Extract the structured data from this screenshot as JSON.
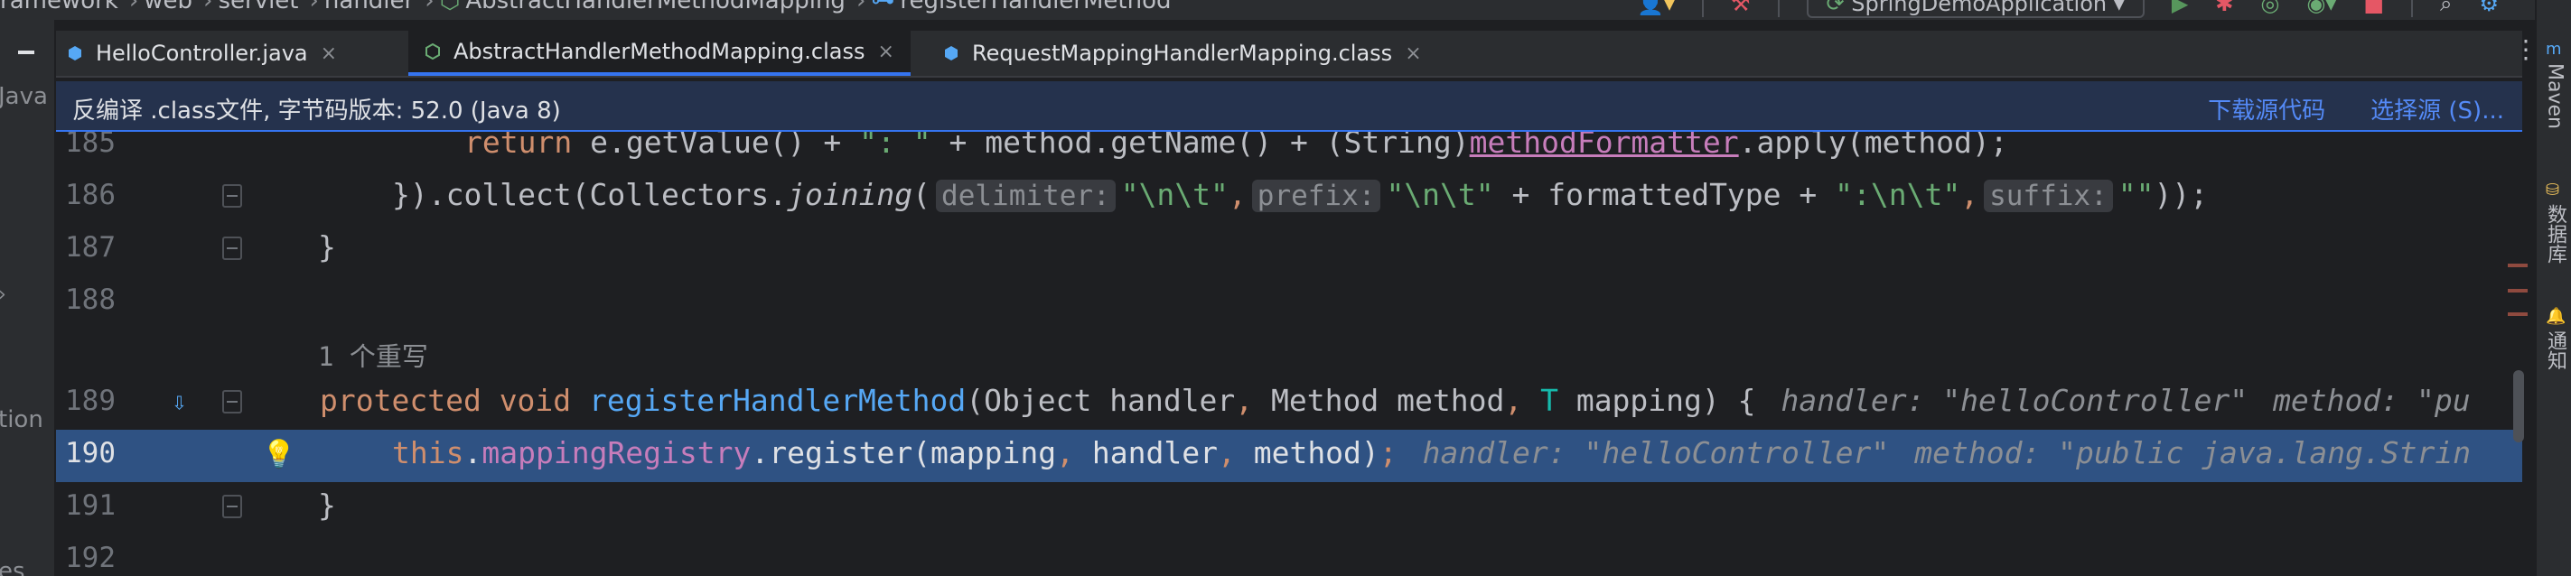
{
  "breadcrumb": {
    "items": [
      "ramework",
      "web",
      "servlet",
      "handler",
      "AbstractHandlerMethodMapping",
      "registerHandlerMethod"
    ]
  },
  "toolbar": {
    "run_config": "SpringDemoApplication"
  },
  "left_panel": {
    "fragments": [
      "Java",
      "tion",
      "es"
    ]
  },
  "tabs": [
    {
      "label": "HelloController.java",
      "close": "×",
      "icon": "java-class-icon"
    },
    {
      "label": "AbstractHandlerMethodMapping.class",
      "close": "×",
      "icon": "abstract-class-icon",
      "active": true
    },
    {
      "label": "RequestMappingHandlerMapping.class",
      "close": "×",
      "icon": "class-file-icon"
    }
  ],
  "banner": {
    "message": "反编译 .class文件, 字节码版本: 52.0 (Java 8)",
    "download_source": "下载源代码",
    "choose_source": "选择源 (S)..."
  },
  "editor": {
    "lines": [
      {
        "num": "185"
      },
      {
        "num": "186"
      },
      {
        "num": "187"
      },
      {
        "num": "188"
      },
      {
        "num": "189"
      },
      {
        "num": "190"
      },
      {
        "num": "191"
      },
      {
        "num": "192"
      }
    ],
    "usage_hint": "1 个重写",
    "code": {
      "l185_return": "return",
      "l185_a": " e.getValue() + ",
      "l185_str": "\": \"",
      "l185_b": " + method.getName() + (String)",
      "l185_static": "methodFormatter",
      "l185_c": ".apply(method);",
      "l186_a": "}).collect(Collectors.",
      "l186_joining": "joining",
      "l186_paren": "(",
      "l186_h1": "delimiter:",
      "l186_s1": "\"\\n\\t\"",
      "l186_comma1": ",",
      "l186_h2": "prefix:",
      "l186_s2": "\"\\n\\t\"",
      "l186_b": " + formattedType + ",
      "l186_s3": "\":\\n\\t\"",
      "l186_comma2": ",",
      "l186_h3": "suffix:",
      "l186_s4": "\"\"",
      "l186_end": "));",
      "l187": "}",
      "l189_protected": "protected",
      "l189_void": "void",
      "l189_name": "registerHandlerMethod",
      "l189_a": "(Object handler",
      "l189_comma1": ",",
      "l189_b": " Method method",
      "l189_comma2": ",",
      "l189_t": "T",
      "l189_c": " mapping) {",
      "l189_inlay1": "handler: \"helloController\"",
      "l189_inlay2": "method: \"pu",
      "l190_this": "this",
      "l190_dot": ".",
      "l190_field": "mappingRegistry",
      "l190_a": ".register(mapping",
      "l190_comma1": ",",
      "l190_b": " handler",
      "l190_comma2": ",",
      "l190_c": " method)",
      "l190_semi": ";",
      "l190_inlay1": "handler: \"helloController\"",
      "l190_inlay2": "method: \"public java.lang.Strin",
      "l191": "}"
    }
  },
  "right_tools": [
    "Maven",
    "数据库",
    "通知"
  ],
  "colors": {
    "editor_bg": "#1e1f22",
    "panel_bg": "#2b2d30",
    "keyword": "#cf8e6d",
    "function": "#56a8f5",
    "string": "#6aab73",
    "field": "#c77dbb",
    "highlight_line": "#2f5283",
    "accent": "#3574f0"
  }
}
